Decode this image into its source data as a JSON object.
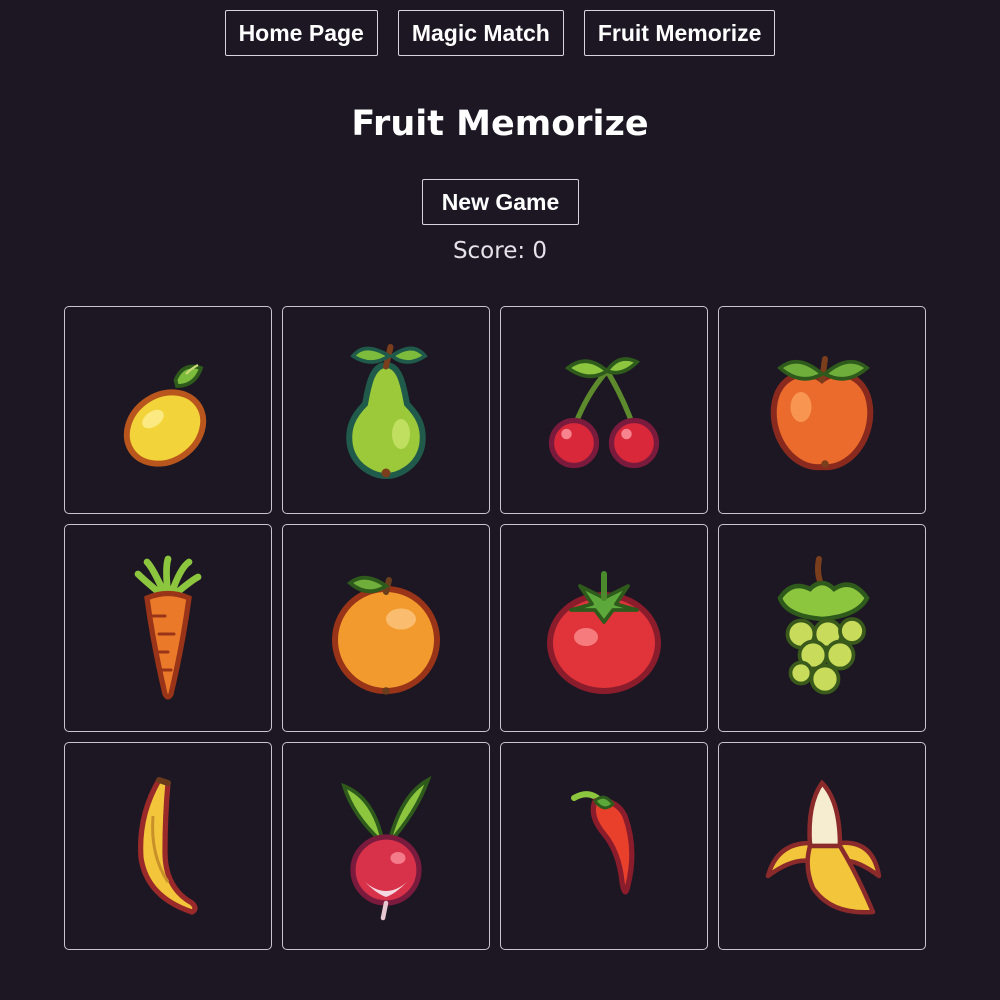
{
  "nav": {
    "items": [
      {
        "label": "Home Page"
      },
      {
        "label": "Magic Match"
      },
      {
        "label": "Fruit Memorize"
      }
    ]
  },
  "game": {
    "title": "Fruit Memorize",
    "new_game_label": "New Game",
    "score_label": "Score: 0",
    "score": 0
  },
  "board": {
    "columns": 4,
    "rows": 3,
    "cards": [
      {
        "item": "lemon-icon"
      },
      {
        "item": "pear-icon"
      },
      {
        "item": "cherry-icon"
      },
      {
        "item": "apple-icon"
      },
      {
        "item": "carrot-icon"
      },
      {
        "item": "orange-icon"
      },
      {
        "item": "tomato-icon"
      },
      {
        "item": "grapes-icon"
      },
      {
        "item": "banana-icon"
      },
      {
        "item": "radish-icon"
      },
      {
        "item": "chili-pepper-icon"
      },
      {
        "item": "peeled-banana-icon"
      }
    ]
  },
  "colors": {
    "background": "#1c1723",
    "border": "#d8d4de",
    "text": "#ffffff"
  }
}
